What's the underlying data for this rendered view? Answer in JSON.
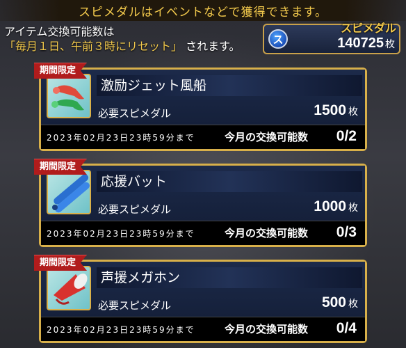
{
  "banner": "スピメダルはイベントなどで獲得できます。",
  "info": {
    "line1": "アイテム交換可能数は",
    "line2_highlight": "「毎月１日、午前３時にリセット」",
    "line2_rest": "されます。"
  },
  "balance": {
    "title": "スピメダル",
    "icon_letter": "ス",
    "value": "140725",
    "unit": "枚"
  },
  "items": [
    {
      "tag": "期間限定",
      "icon": "jet-balloon-icon",
      "name": "激励ジェット風船",
      "req_label": "必要スピメダル",
      "req_value": "1500",
      "unit": "枚",
      "deadline": "2023年02月23日23時59分まで",
      "limit_label": "今月の交換可能数",
      "limit_value": "0/2"
    },
    {
      "tag": "期間限定",
      "icon": "cheer-bat-icon",
      "name": "応援バット",
      "req_label": "必要スピメダル",
      "req_value": "1000",
      "unit": "枚",
      "deadline": "2023年02月23日23時59分まで",
      "limit_label": "今月の交換可能数",
      "limit_value": "0/3"
    },
    {
      "tag": "期間限定",
      "icon": "megaphone-icon",
      "name": "声援メガホン",
      "req_label": "必要スピメダル",
      "req_value": "500",
      "unit": "枚",
      "deadline": "2023年02月23日23時59分まで",
      "limit_label": "今月の交換可能数",
      "limit_value": "0/4"
    }
  ],
  "colors": {
    "gold": "#d8b04a",
    "tag_red": "#b11c1c",
    "card_blue": "#1c2a4a"
  }
}
